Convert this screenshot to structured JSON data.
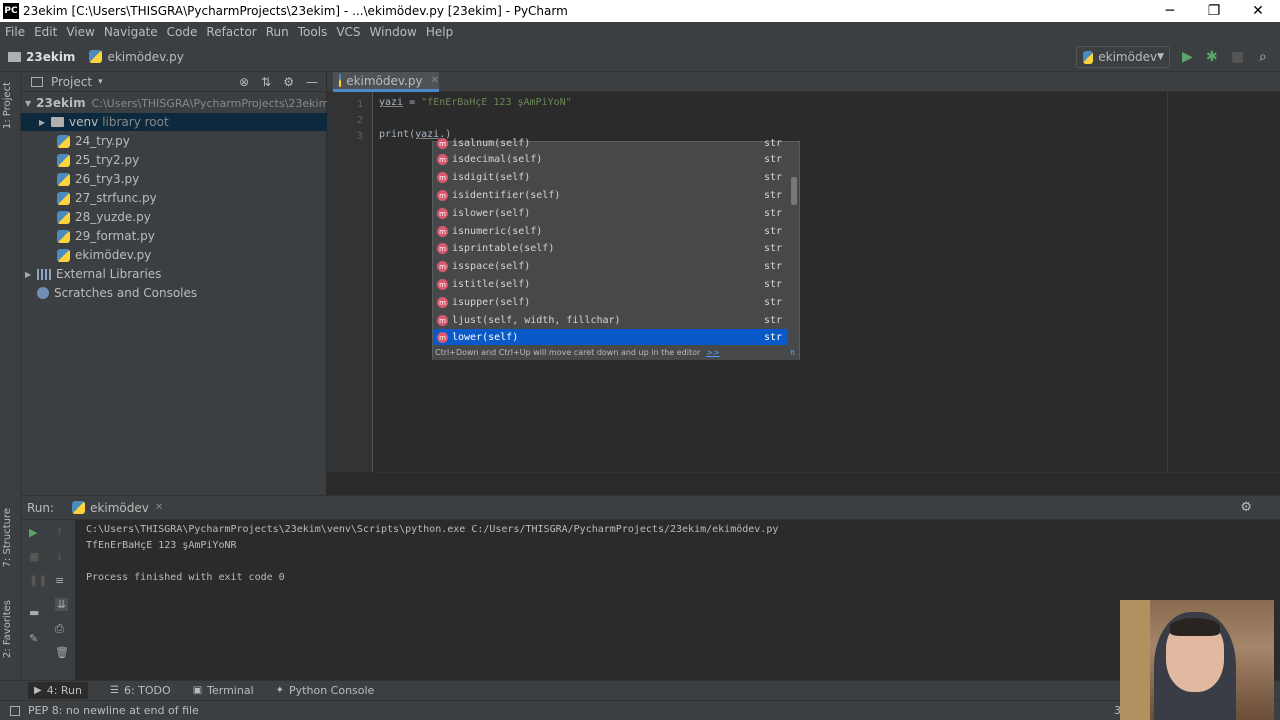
{
  "window": {
    "app_icon": "PC",
    "title": "23ekim [C:\\Users\\THISGRA\\PycharmProjects\\23ekim] - ...\\ekimödev.py [23ekim] - PyCharm",
    "minimize": "─",
    "restore": "❐",
    "close": "✕"
  },
  "menu": [
    "File",
    "Edit",
    "View",
    "Navigate",
    "Code",
    "Refactor",
    "Run",
    "Tools",
    "VCS",
    "Window",
    "Help"
  ],
  "navbar": {
    "project": "23ekim",
    "file": "ekimödev.py",
    "run_config": "ekimödev",
    "run_icon": "▶",
    "debug_icon": "✱",
    "stop_icon": "■",
    "search_icon": "⌕"
  },
  "left_stripe": {
    "project_tab": "1: Project",
    "structure_tab": "7: Structure",
    "favorites_tab": "2: Favorites"
  },
  "project_panel": {
    "title": "Project",
    "dropdown": "▾",
    "icons": {
      "locate": "⊗",
      "collapse": "⇅",
      "settings": "⚙",
      "hide": "—"
    },
    "root": {
      "name": "23ekim",
      "path": "C:\\Users\\THISGRA\\PycharmProjects\\23ekim"
    },
    "venv": {
      "name": "venv",
      "note": "library root"
    },
    "files": [
      "24_try.py",
      "25_try2.py",
      "26_try3.py",
      "27_strfunc.py",
      "28_yuzde.py",
      "29_format.py",
      "ekimödev.py"
    ],
    "external": "External Libraries",
    "scratches": "Scratches and Consoles"
  },
  "editor": {
    "tab": "ekimödev.py",
    "lines": [
      {
        "num": "1",
        "var": "yazi",
        "eq": " = ",
        "str": "\"fEnErBaHçE 123 şAmPiYoN\""
      },
      {
        "num": "2"
      },
      {
        "num": "3",
        "fn": "print(",
        "var": "yazi",
        "rest": ".)"
      }
    ]
  },
  "completion": {
    "items": [
      {
        "name": "isalnum(self)",
        "type": "str"
      },
      {
        "name": "isdecimal(self)",
        "type": "str"
      },
      {
        "name": "isdigit(self)",
        "type": "str"
      },
      {
        "name": "isidentifier(self)",
        "type": "str"
      },
      {
        "name": "islower(self)",
        "type": "str"
      },
      {
        "name": "isnumeric(self)",
        "type": "str"
      },
      {
        "name": "isprintable(self)",
        "type": "str"
      },
      {
        "name": "isspace(self)",
        "type": "str"
      },
      {
        "name": "istitle(self)",
        "type": "str"
      },
      {
        "name": "isupper(self)",
        "type": "str"
      },
      {
        "name": "ljust(self, width, fillchar)",
        "type": "str"
      },
      {
        "name": "lower(self)",
        "type": "str"
      }
    ],
    "selected_index": 11,
    "hint": "Ctrl+Down and Ctrl+Up will move caret down and up in the editor",
    "hint_link": ">>",
    "pi": "π"
  },
  "run_panel": {
    "label": "Run:",
    "tab": "ekimödev",
    "settings_icon": "⚙",
    "output": [
      "C:\\Users\\THISGRA\\PycharmProjects\\23ekim\\venv\\Scripts\\python.exe C:/Users/THISGRA/PycharmProjects/23ekim/ekimödev.py",
      "TfEnErBaHçE 123 şAmPiYoNR",
      "",
      "Process finished with exit code 0"
    ]
  },
  "bottom_tabs": [
    {
      "icon": "▶",
      "label": "4: Run",
      "active": true
    },
    {
      "icon": "☰",
      "label": "6: TODO",
      "active": false
    },
    {
      "icon": "▣",
      "label": "Terminal",
      "active": false
    },
    {
      "icon": "✦",
      "label": "Python Console",
      "active": false
    }
  ],
  "status": {
    "message": "PEP 8: no newline at end of file",
    "right_fragment": "3"
  },
  "colors": {
    "background": "#2b2b2b",
    "panel": "#3c3f41",
    "selection": "#0a59c9",
    "string": "#6a8759",
    "method_icon": "#d9596f"
  }
}
